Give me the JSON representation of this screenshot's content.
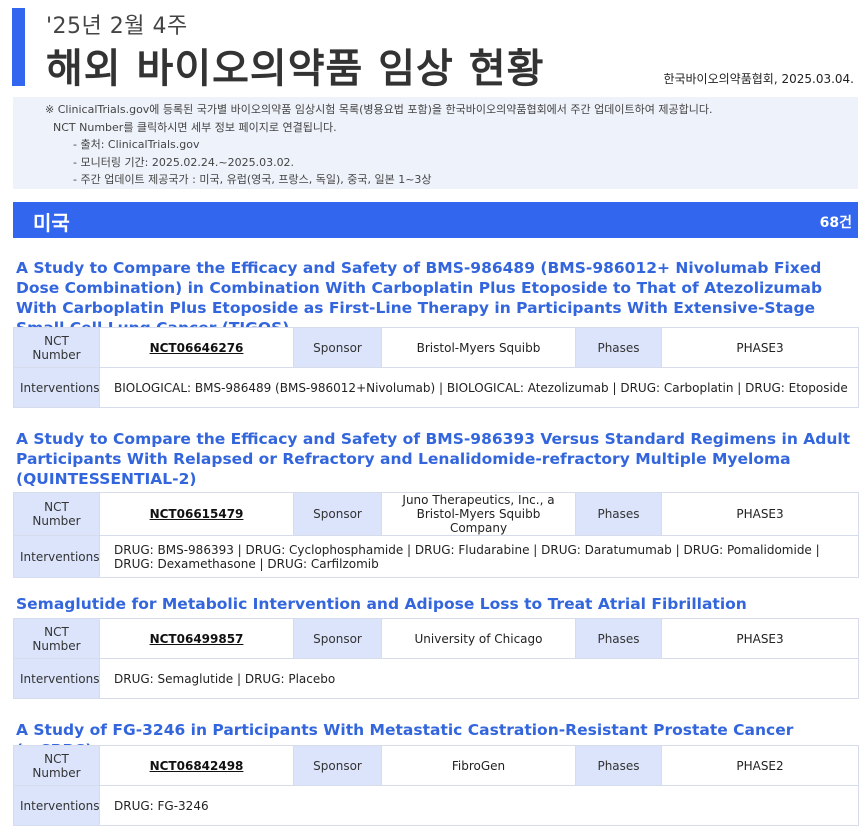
{
  "header": {
    "subtitle": "'25년 2월 4주",
    "title": "해외 바이오의약품 임상 현황",
    "org_date": "한국바이오의약품협회, 2025.03.04."
  },
  "notice": {
    "line1": "※ ClinicalTrials.gov에 등록된 국가별 바이오의약품 임상시험 목록(병용요법 포함)을 한국바이오의약품협회에서 주간 업데이트하여 제공합니다.",
    "line2": "NCT Number를 클릭하시면 세부 정보 페이지로 연결됩니다.",
    "source": "- 출처: ClinicalTrials.gov",
    "period": "- 모니터링 기간: 2025.02.24.~2025.03.02.",
    "countries": "- 주간 업데이트 제공국가 : 미국, 유럽(영국, 프랑스, 독일), 중국, 일본 1~3상"
  },
  "section": {
    "name": "미국",
    "count": "68건"
  },
  "labels": {
    "nct": "NCT Number",
    "sponsor": "Sponsor",
    "phases": "Phases",
    "interventions": "Interventions"
  },
  "trials": [
    {
      "title": "A Study to Compare the Efficacy and Safety of BMS-986489 (BMS-986012+ Nivolumab Fixed Dose Combination) in Combination With Carboplatin Plus Etoposide to That of Atezolizumab With Carboplatin Plus Etoposide as First-Line Therapy in Participants With Extensive-Stage Small Cell Lung Cancer (TIGOS).",
      "nct": "NCT06646276",
      "sponsor": "Bristol-Myers Squibb",
      "phase": "PHASE3",
      "interventions": "BIOLOGICAL: BMS-986489 (BMS-986012+Nivolumab) | BIOLOGICAL: Atezolizumab | DRUG: Carboplatin | DRUG: Etoposide"
    },
    {
      "title": "A Study to Compare the Efficacy and Safety of BMS-986393 Versus Standard Regimens in Adult Participants With Relapsed or Refractory and Lenalidomide-refractory Multiple Myeloma (QUINTESSENTIAL-2)",
      "nct": "NCT06615479",
      "sponsor": "Juno Therapeutics, Inc., a Bristol-Myers Squibb Company",
      "phase": "PHASE3",
      "interventions": "DRUG: BMS-986393 | DRUG: Cyclophosphamide | DRUG: Fludarabine | DRUG: Daratumumab | DRUG: Pomalidomide | DRUG: Dexamethasone | DRUG: Carfilzomib"
    },
    {
      "title": "Semaglutide for Metabolic Intervention and Adipose Loss to Treat Atrial Fibrillation",
      "nct": "NCT06499857",
      "sponsor": "University of Chicago",
      "phase": "PHASE3",
      "interventions": "DRUG: Semaglutide | DRUG: Placebo"
    },
    {
      "title": "A Study of FG-3246 in Participants With Metastatic Castration-Resistant Prostate Cancer (mCRPC)",
      "nct": "NCT06842498",
      "sponsor": "FibroGen",
      "phase": "PHASE2",
      "interventions": "DRUG: FG-3246"
    }
  ]
}
